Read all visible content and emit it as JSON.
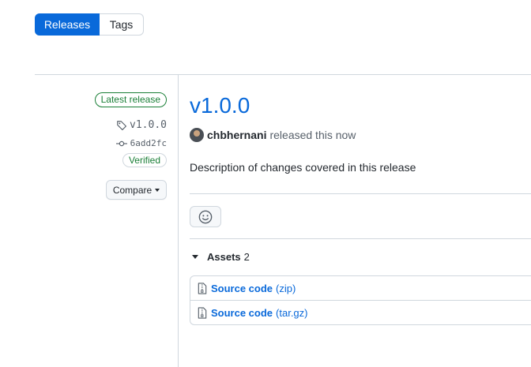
{
  "tabs": {
    "releases": "Releases",
    "tags": "Tags"
  },
  "sidebar": {
    "latest_badge": "Latest release",
    "tag": "v1.0.0",
    "commit": "6add2fc",
    "verified_badge": "Verified",
    "compare_label": "Compare"
  },
  "release": {
    "title": "v1.0.0",
    "author": "chbhernani",
    "released_text": "released this now",
    "description": "Description of changes covered in this release"
  },
  "assets": {
    "label": "Assets",
    "count": "2",
    "items": [
      {
        "name": "Source code",
        "format": "(zip)"
      },
      {
        "name": "Source code",
        "format": "(tar.gz)"
      }
    ]
  },
  "icons": [
    "tag-icon",
    "commit-icon",
    "smiley-icon",
    "file-zip-icon",
    "caret-down-icon"
  ],
  "colors": {
    "accent": "#0969da",
    "success": "#1a7f37",
    "border": "#d0d7de"
  }
}
